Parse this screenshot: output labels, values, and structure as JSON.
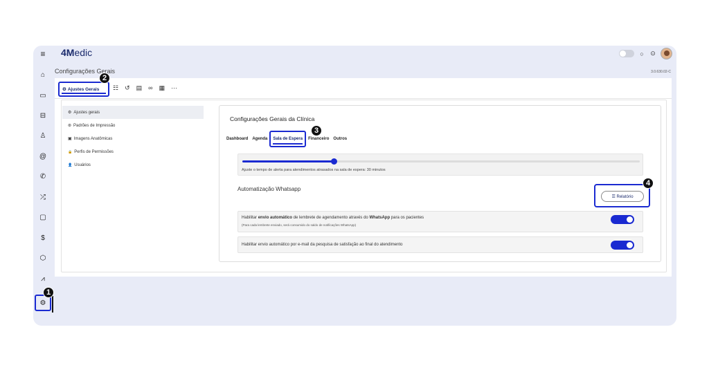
{
  "app": {
    "logo_bold": "4M",
    "logo_rest": "edic",
    "version": "3.0.630.02-C"
  },
  "page": {
    "title": "Configurações Gerais"
  },
  "sidebar": {
    "icons": [
      "menu-icon",
      "home-icon",
      "calendar-icon",
      "sofa-icon",
      "user-icon",
      "at-icon",
      "phone-icon",
      "shuffle-icon",
      "clipboard-icon",
      "dollar-icon",
      "box-icon",
      "chart-icon",
      "settings-icon"
    ]
  },
  "topbar": {
    "icons": [
      "theme-toggle",
      "chat-icon",
      "help-icon",
      "avatar"
    ]
  },
  "tabs": {
    "active_label": "Ajustes Gerais",
    "icons": [
      "list-icon",
      "history-icon",
      "card-icon",
      "link-icon",
      "calendar-icon",
      "more-icon"
    ]
  },
  "menu": [
    {
      "label": "Ajustes gerais",
      "icon": "⚙",
      "active": true
    },
    {
      "label": "Padrões de Impressão",
      "icon": "⊛",
      "active": false
    },
    {
      "label": "Imagens Anatômicas",
      "icon": "▣",
      "active": false
    },
    {
      "label": "Perfis de Permissões",
      "icon": "🔒",
      "active": false
    },
    {
      "label": "Usuários",
      "icon": "👤",
      "active": false
    }
  ],
  "content": {
    "title": "Configurações Gerais da Clínica",
    "subtabs": [
      "Dashboard",
      "Agenda",
      "Sala de Espera",
      "Financeiro",
      "Outros"
    ],
    "active_subtab": "Sala de Espera",
    "slider": {
      "value": 0.23,
      "text": "Ajuste o tempo de alerta para atendimentos atrasados na sala de espera: 30 minutos"
    },
    "auto_title": "Automatização Whatsapp",
    "report_button": "☰ Relatório",
    "row1": {
      "pre": "Habilitar ",
      "b1": "envio automático",
      "mid": " de lembrete de agendamento através do ",
      "b2": "WhatsApp",
      "post": " para os pacientes",
      "sub": "(Para cada lembrete enviado, será consumido do saldo de notificações WhatsApp)",
      "enabled": true
    },
    "row2": {
      "text": "Habilitar envio automático por e-mail da pesquisa de satisfação ao final do atendimento",
      "enabled": true
    }
  },
  "badges": [
    "1",
    "2",
    "3",
    "4"
  ],
  "colors": {
    "accent": "#1a2ad1",
    "frame_bg": "#e8ebf7"
  }
}
